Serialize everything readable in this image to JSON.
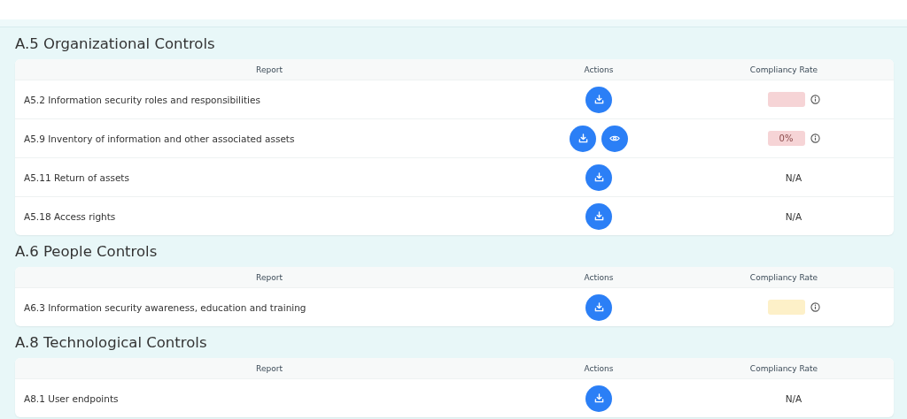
{
  "sections": [
    {
      "title": "A.5 Organizational Controls",
      "columns": [
        "Report",
        "Actions",
        "Compliancy Rate"
      ],
      "rows": [
        {
          "report": "A5.2 Information security roles and responsibilities",
          "actions": [
            {
              "kind": "download"
            }
          ],
          "rate": {
            "kind": "badge",
            "color": "#f6d4d6"
          }
        },
        {
          "report": "A5.9 Inventory of information and other associated assets",
          "actions": [
            {
              "kind": "download"
            },
            {
              "kind": "view"
            }
          ],
          "rate": {
            "kind": "badge",
            "color": "#f6d4d6",
            "text": "0%"
          }
        },
        {
          "report": "A5.11 Return of assets",
          "actions": [
            {
              "kind": "download"
            }
          ],
          "rate": {
            "kind": "text",
            "text": "N/A"
          }
        },
        {
          "report": "A5.18 Access rights",
          "actions": [
            {
              "kind": "download"
            }
          ],
          "rate": {
            "kind": "text",
            "text": "N/A"
          }
        }
      ]
    },
    {
      "title": "A.6 People Controls",
      "columns": [
        "Report",
        "Actions",
        "Compliancy Rate"
      ],
      "rows": [
        {
          "report": "A6.3 Information security awareness, education and training",
          "actions": [
            {
              "kind": "download"
            }
          ],
          "rate": {
            "kind": "badge",
            "color": "#fdf0c8"
          }
        }
      ]
    },
    {
      "title": "A.8 Technological Controls",
      "columns": [
        "Report",
        "Actions",
        "Compliancy Rate"
      ],
      "rows": [
        {
          "report": "A8.1 User endpoints",
          "actions": [
            {
              "kind": "download"
            }
          ],
          "rate": {
            "kind": "text",
            "text": "N/A"
          }
        }
      ]
    }
  ]
}
